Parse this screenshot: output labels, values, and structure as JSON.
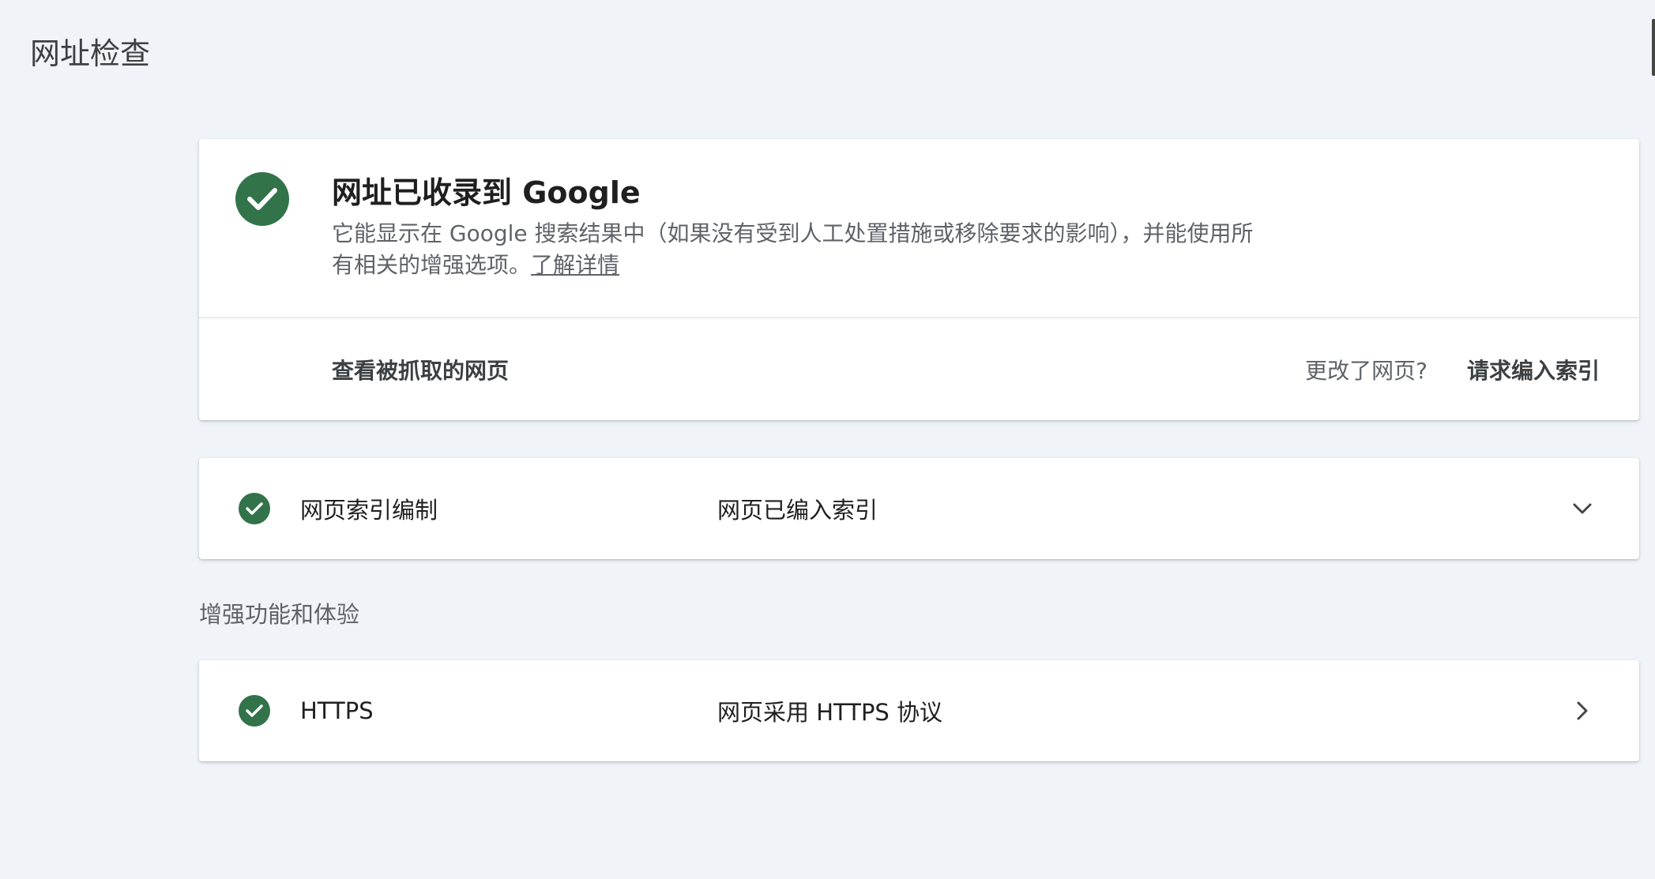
{
  "page": {
    "title": "网址检查"
  },
  "status": {
    "title": "网址已收录到 Google",
    "description": "它能显示在 Google 搜索结果中（如果没有受到人工处置措施或移除要求的影响），并能使用所有相关的增强选项。",
    "learn_more": "了解详情",
    "icon": "check-circle-icon",
    "color": "#32734a"
  },
  "actions": {
    "view_crawled": "查看被抓取的网页",
    "changed_prompt": "更改了网页?",
    "request_indexing": "请求编入索引"
  },
  "indexing": {
    "name": "网页索引编制",
    "value": "网页已编入索引",
    "icon": "chevron-down-icon"
  },
  "enhancements": {
    "heading": "增强功能和体验",
    "items": [
      {
        "name": "HTTPS",
        "value": "网页采用 HTTPS 协议",
        "icon": "chevron-right-icon"
      }
    ]
  }
}
